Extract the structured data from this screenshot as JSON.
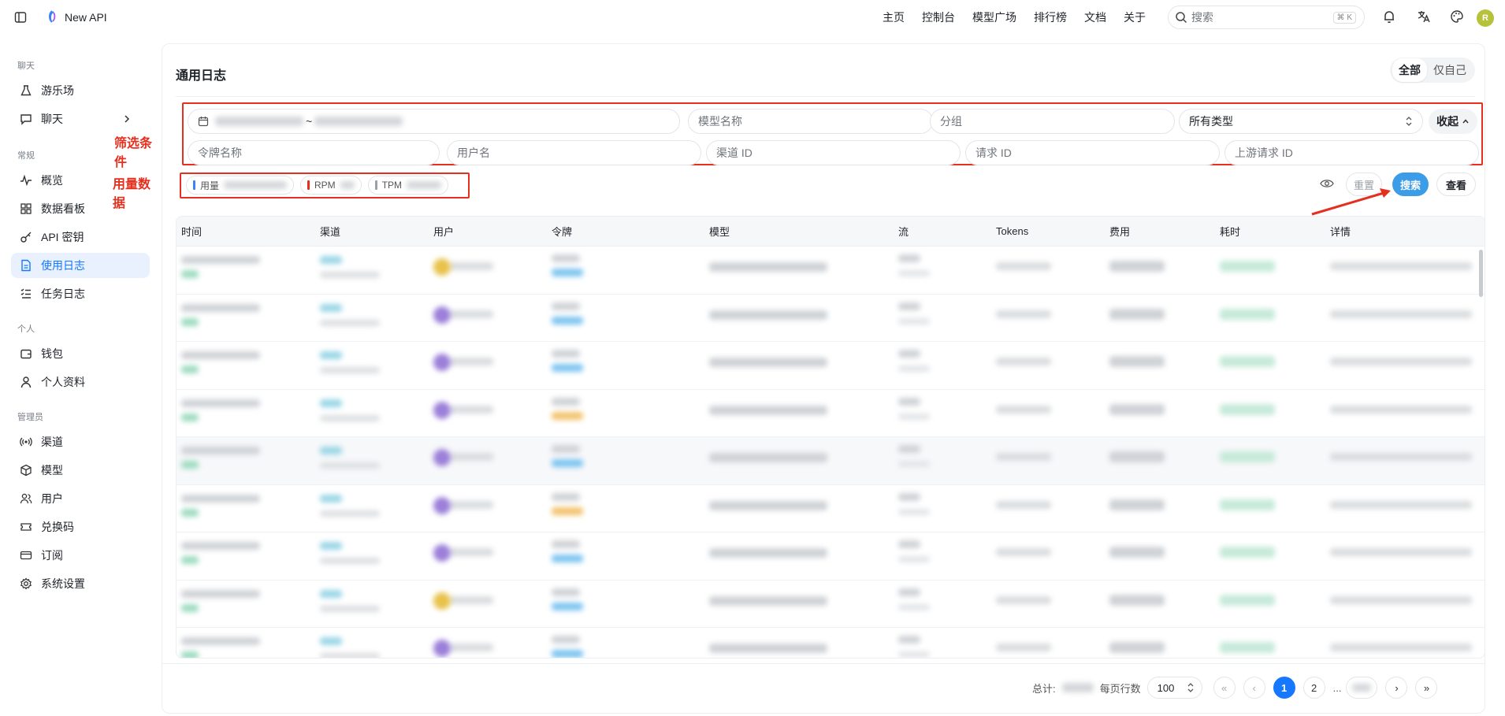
{
  "app": {
    "title": "New API"
  },
  "topnav": {
    "items": [
      "主页",
      "控制台",
      "模型广场",
      "排行榜",
      "文档",
      "关于"
    ],
    "search_placeholder": "搜索",
    "search_shortcut": "⌘ K",
    "avatar": "R"
  },
  "sidebar": {
    "sections": [
      {
        "title": "聊天",
        "items": [
          {
            "label": "游乐场",
            "icon": "flask-icon"
          },
          {
            "label": "聊天",
            "icon": "message-icon"
          }
        ]
      },
      {
        "title": "常规",
        "items": [
          {
            "label": "概览",
            "icon": "activity-icon"
          },
          {
            "label": "数据看板",
            "icon": "dashboard-icon"
          },
          {
            "label": "API 密钥",
            "icon": "key-icon"
          },
          {
            "label": "使用日志",
            "icon": "file-icon",
            "active": true
          },
          {
            "label": "任务日志",
            "icon": "list-icon"
          }
        ]
      },
      {
        "title": "个人",
        "items": [
          {
            "label": "钱包",
            "icon": "wallet-icon"
          },
          {
            "label": "个人资料",
            "icon": "user-icon"
          }
        ]
      },
      {
        "title": "管理员",
        "items": [
          {
            "label": "渠道",
            "icon": "radio-icon"
          },
          {
            "label": "模型",
            "icon": "box-icon"
          },
          {
            "label": "用户",
            "icon": "users-icon"
          },
          {
            "label": "兑换码",
            "icon": "ticket-icon"
          },
          {
            "label": "订阅",
            "icon": "card-icon"
          },
          {
            "label": "系统设置",
            "icon": "gear-icon"
          }
        ]
      }
    ]
  },
  "page": {
    "title": "通用日志",
    "scope": [
      "全部",
      "仅自己"
    ]
  },
  "annotations": {
    "filter": "筛选条件",
    "usage": "用量数据"
  },
  "filters": {
    "date_sep": "~",
    "model": "模型名称",
    "group": "分组",
    "type": "所有类型",
    "collapse": "收起",
    "token": "令牌名称",
    "username": "用户名",
    "channel": "渠道 ID",
    "request": "请求 ID",
    "upstream": "上游请求 ID"
  },
  "stats": {
    "usage": "用量",
    "rpm": "RPM",
    "tpm": "TPM"
  },
  "actions": {
    "reset": "重置",
    "search": "搜索",
    "view": "查看"
  },
  "table": {
    "headers": [
      "时间",
      "渠道",
      "用户",
      "令牌",
      "模型",
      "流",
      "Tokens",
      "费用",
      "耗时",
      "详情"
    ]
  },
  "pagination": {
    "total_label": "总计:",
    "per_page_label": "每页行数",
    "per_page": "100",
    "pages": [
      "1",
      "2",
      "..."
    ]
  },
  "colors": {
    "accent": "#1677ff",
    "annotation": "#e5301f",
    "search_btn": "#3b9ce8"
  }
}
